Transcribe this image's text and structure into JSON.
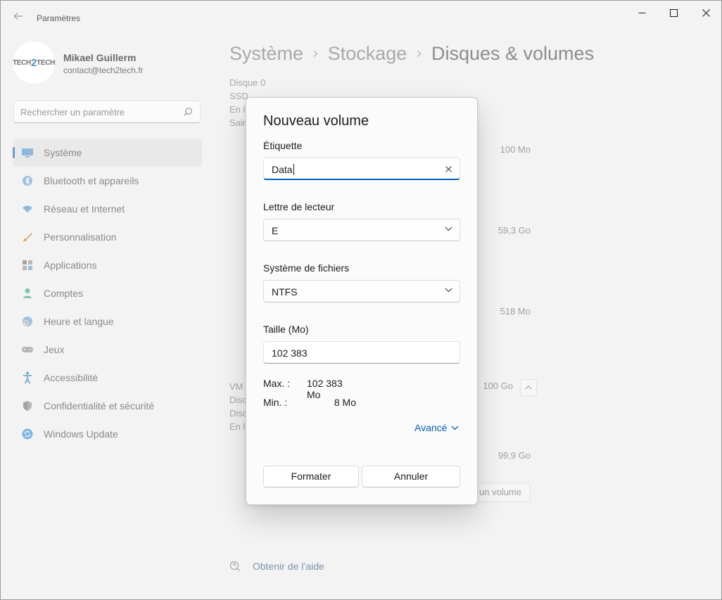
{
  "window": {
    "title": "Paramètres"
  },
  "profile": {
    "name": "Mikael Guillerm",
    "email": "contact@tech2tech.fr",
    "avatar_text_left": "TECH",
    "avatar_text_mid": "2",
    "avatar_text_right": "TECH"
  },
  "search": {
    "placeholder": "Rechercher un paramètre"
  },
  "sidebar": {
    "items": [
      {
        "label": "Système",
        "icon": "monitor-icon",
        "active": true
      },
      {
        "label": "Bluetooth et appareils",
        "icon": "bluetooth-icon"
      },
      {
        "label": "Réseau et Internet",
        "icon": "wifi-icon"
      },
      {
        "label": "Personnalisation",
        "icon": "brush-icon"
      },
      {
        "label": "Applications",
        "icon": "apps-icon"
      },
      {
        "label": "Comptes",
        "icon": "person-icon"
      },
      {
        "label": "Heure et langue",
        "icon": "clock-globe-icon"
      },
      {
        "label": "Jeux",
        "icon": "gamepad-icon"
      },
      {
        "label": "Accessibilité",
        "icon": "accessibility-icon"
      },
      {
        "label": "Confidentialité et sécurité",
        "icon": "shield-icon"
      },
      {
        "label": "Windows Update",
        "icon": "update-icon"
      }
    ]
  },
  "main": {
    "breadcrumb": [
      "Système",
      "Stockage",
      "Disques & volumes"
    ],
    "disk0": {
      "title": "Disque 0",
      "line1": "SSD",
      "line2": "En l",
      "line3": "Sain"
    },
    "disk1": {
      "title": "VM",
      "line1": "Disc",
      "line2": "Disc",
      "line3": "En l"
    },
    "sizes": [
      "100 Mo",
      "59,3 Go",
      "518 Mo",
      "100 Go",
      "99,9 Go"
    ],
    "bg_button_label": "un volume",
    "help_label": "Obtenir de l’aide"
  },
  "dialog": {
    "title": "Nouveau volume",
    "label_field": {
      "label": "Étiquette",
      "value": "Data"
    },
    "drive_letter": {
      "label": "Lettre de lecteur",
      "value": "E"
    },
    "filesystem": {
      "label": "Système de fichiers",
      "value": "NTFS"
    },
    "size": {
      "label": "Taille (Mo)",
      "value": "102 383"
    },
    "max": {
      "label": "Max. :",
      "value": "102 383 Mo"
    },
    "min": {
      "label": "Min. :",
      "value": "8 Mo"
    },
    "advanced_label": "Avancé",
    "format_button": "Formater",
    "cancel_button": "Annuler"
  },
  "colors": {
    "accent": "#005fb8",
    "window_bg": "#f3f3f3",
    "dialog_bg": "#fbfbfb"
  }
}
